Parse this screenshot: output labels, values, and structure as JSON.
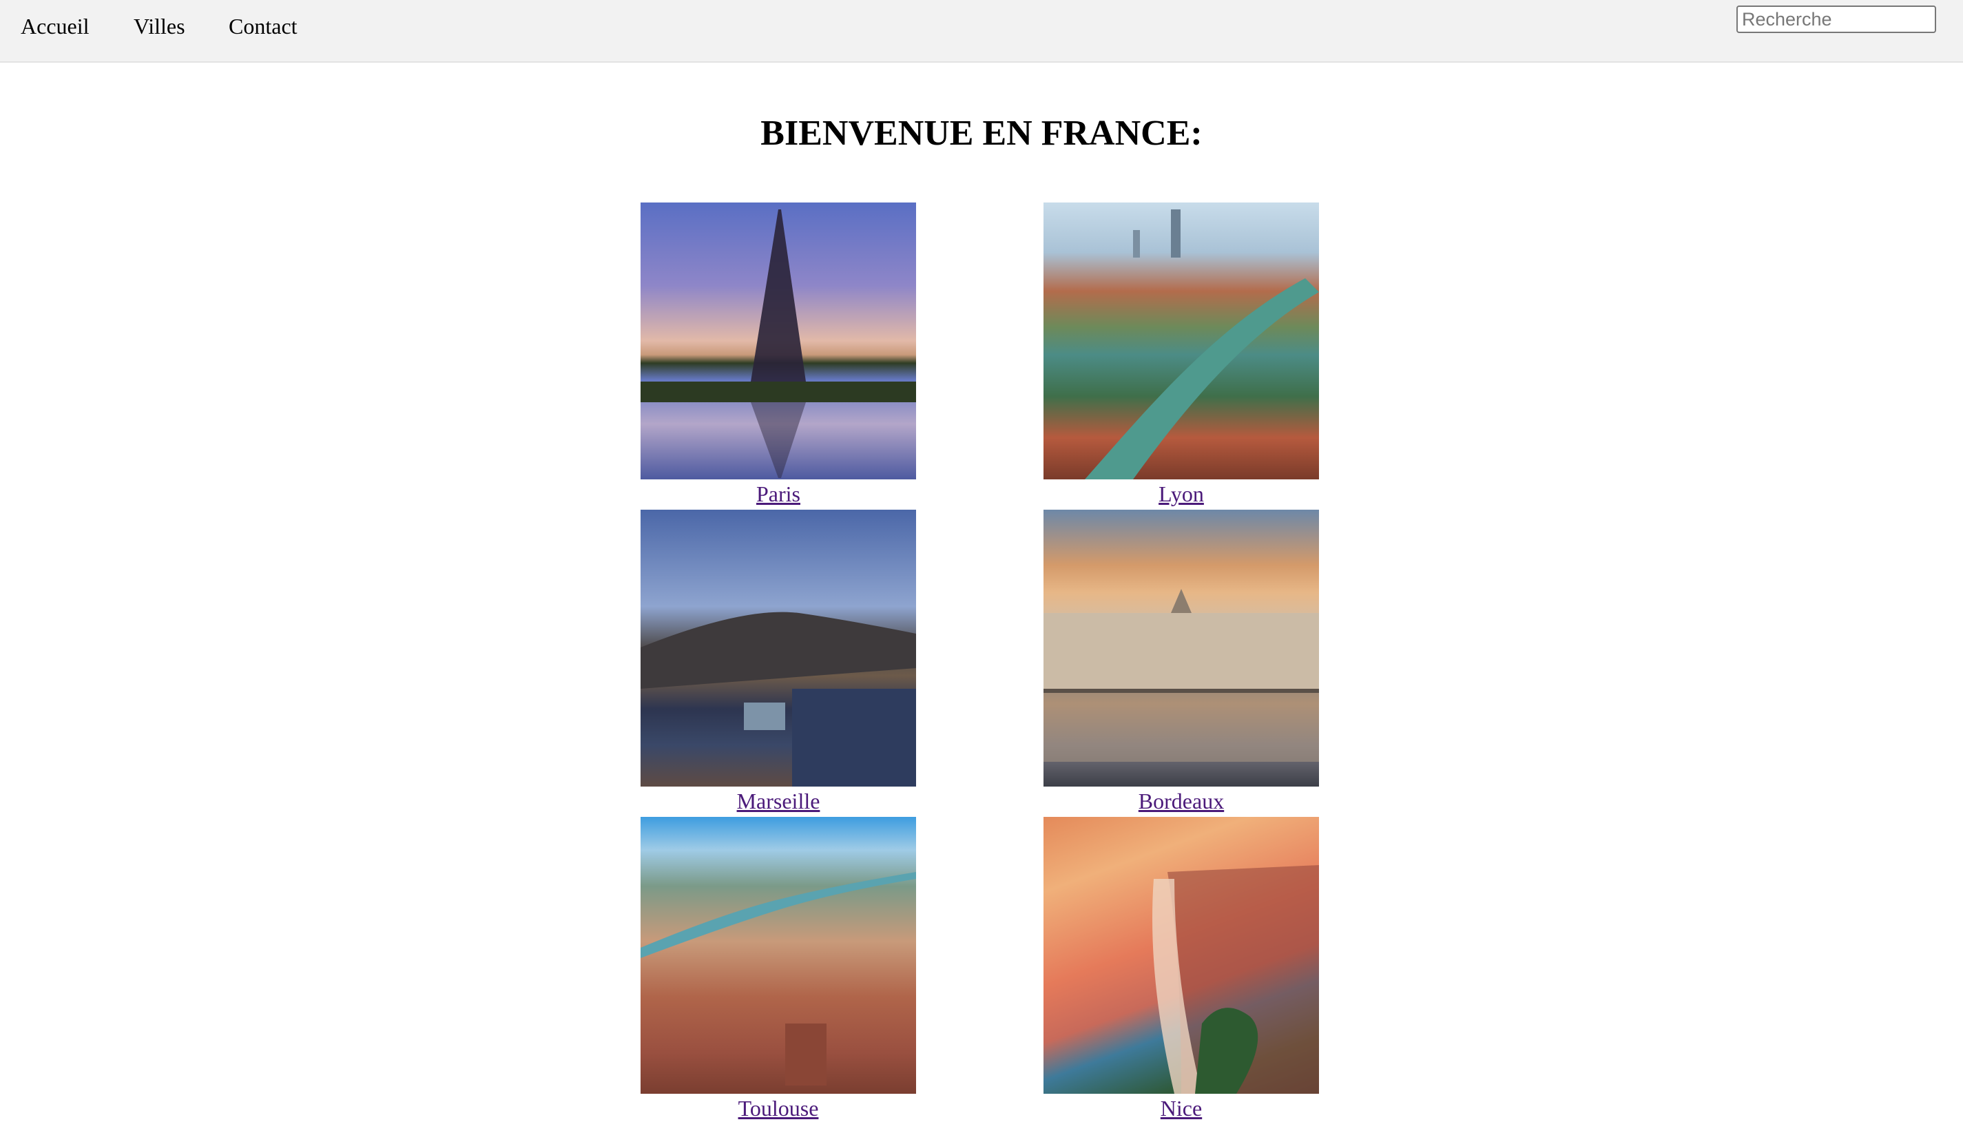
{
  "nav": {
    "links": [
      "Accueil",
      "Villes",
      "Contact"
    ],
    "search_placeholder": "Recherche"
  },
  "main": {
    "title": "BIENVENUE EN FRANCE:",
    "cities": [
      {
        "name": "Paris",
        "image": "eiffel-tower-photo"
      },
      {
        "name": "Lyon",
        "image": "lyon-river-photo"
      },
      {
        "name": "Marseille",
        "image": "marseille-port-photo"
      },
      {
        "name": "Bordeaux",
        "image": "bordeaux-mirror-photo"
      },
      {
        "name": "Toulouse",
        "image": "toulouse-aerial-photo"
      },
      {
        "name": "Nice",
        "image": "nice-promenade-photo"
      }
    ]
  }
}
